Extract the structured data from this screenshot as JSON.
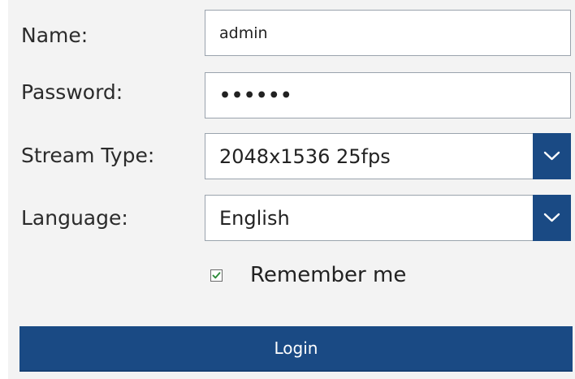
{
  "form": {
    "name_label": "Name:",
    "name_value": "admin",
    "password_label": "Password:",
    "password_value": "••••••",
    "stream_type_label": "Stream Type:",
    "stream_type_value": "2048x1536 25fps",
    "language_label": "Language:",
    "language_value": "English",
    "remember_label": "Remember me",
    "remember_checked": true,
    "login_label": "Login"
  },
  "icons": {
    "dropdown": "chevron-down-icon",
    "checkbox": "checkmark-icon"
  },
  "colors": {
    "accent": "#1a4a84",
    "checkmark": "#2e8b3a",
    "panel_bg": "#f3f3f3"
  }
}
